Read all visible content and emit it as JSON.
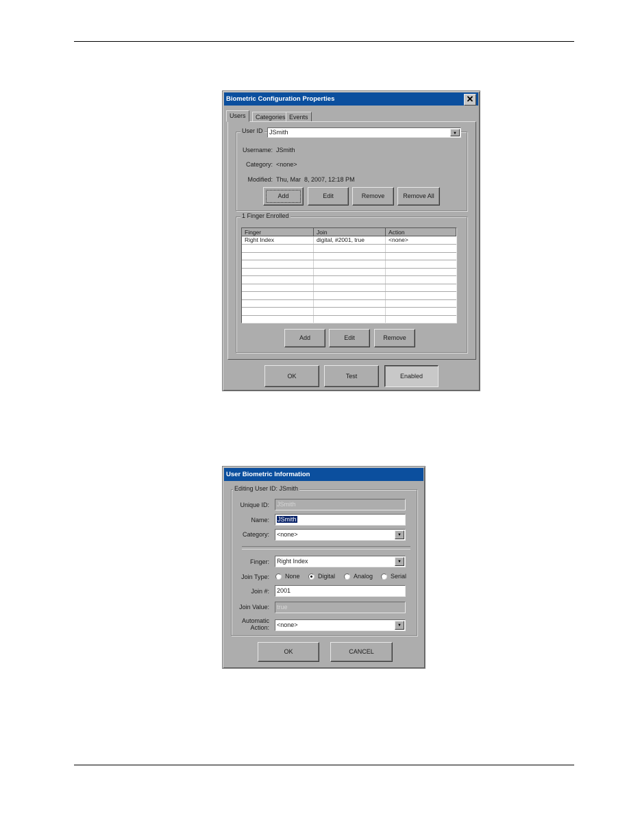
{
  "dialog1": {
    "title": "Biometric Configuration Properties",
    "close_glyph": "✕",
    "tabs": [
      "Users",
      "Categories",
      "Events"
    ],
    "active_tab": "Users",
    "user_group": {
      "label": "User ID",
      "user_id_value": "JSmith",
      "fields": [
        {
          "label": "Username:",
          "value": "JSmith"
        },
        {
          "label": "Category:",
          "value": "<none>"
        },
        {
          "label": "Modified:",
          "value": "Thu, Mar  8, 2007, 12:18 PM"
        }
      ],
      "buttons": [
        "Add",
        "Edit",
        "Remove",
        "Remove All"
      ]
    },
    "finger_group": {
      "label": "1 Finger Enrolled",
      "columns": [
        "Finger",
        "Join",
        "Action"
      ],
      "rows": [
        [
          "Right Index",
          "digital, #2001, true",
          "<none>"
        ]
      ],
      "buttons": [
        "Add",
        "Edit",
        "Remove"
      ]
    },
    "footer_buttons": {
      "ok": "OK",
      "test": "Test",
      "enabled": "Enabled"
    },
    "arrow_glyph": "▼"
  },
  "dialog2": {
    "title": "User Biometric Information",
    "group_label": "Editing User ID: JSmith",
    "unique_id": {
      "label": "Unique ID:",
      "value": "JSmith"
    },
    "name": {
      "label": "Name:",
      "value": "JSmith"
    },
    "category": {
      "label": "Category:",
      "value": "<none>"
    },
    "finger": {
      "label": "Finger:",
      "value": "Right Index"
    },
    "join_type": {
      "label": "Join Type:",
      "options": [
        "None",
        "Digital",
        "Analog",
        "Serial"
      ],
      "selected": "Digital"
    },
    "join_number": {
      "label": "Join #:",
      "value": "2001"
    },
    "join_value": {
      "label": "Join Value:",
      "value": "true"
    },
    "automatic_action": {
      "label_line1": "Automatic",
      "label_line2": "Action:",
      "value": "<none>"
    },
    "buttons": {
      "ok": "OK",
      "cancel": "CANCEL"
    }
  },
  "colors": {
    "titlebar": "#0b4f9e",
    "dialog_bg": "#adadad"
  }
}
